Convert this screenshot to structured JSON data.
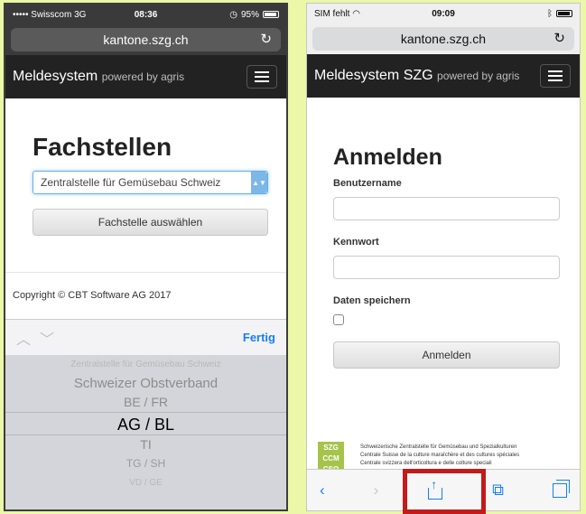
{
  "left": {
    "status": {
      "carrier": "••••• Swisscom  3G",
      "time": "08:36",
      "battery": "95%"
    },
    "url": "kantone.szg.ch",
    "brand": {
      "main": "Meldesystem",
      "sub": "powered by agris"
    },
    "title": "Fachstellen",
    "select_value": "Zentralstelle für Gemüsebau Schweiz",
    "select_button": "Fachstelle auswählen",
    "copyright": "Copyright © CBT Software AG 2017",
    "picker_done": "Fertig",
    "picker_options": [
      "Zentralstelle für Gemüsebau Schweiz",
      "Schweizer Obstverband",
      "BE / FR",
      "AG / BL",
      "TI",
      "TG / SH",
      "VD / GE"
    ],
    "picker_selected": "AG / BL"
  },
  "right": {
    "status": {
      "carrier": "SIM fehlt",
      "time": "09:09"
    },
    "url": "kantone.szg.ch",
    "brand": {
      "main": "Meldesystem SZG",
      "sub": "powered by agris"
    },
    "title": "Anmelden",
    "username_label": "Benutzername",
    "password_label": "Kennwort",
    "remember_label": "Daten speichern",
    "login_button": "Anmelden",
    "footer_logo": [
      "SZG",
      "CCM",
      "CSO"
    ],
    "footer_lines": [
      "Schweizerische Zentralstelle für Gemüsebau und Spezialkulturen",
      "Centrale Suisse de la culture maraîchère et des cultures spéciales",
      "Centrale svizzera dell'orticoltura e delle colture speciali"
    ]
  },
  "colors": {
    "accent_blue": "#147efb",
    "highlight_red": "#c31a1a",
    "navbar": "#222222",
    "page_background": "#ecf7a8"
  }
}
